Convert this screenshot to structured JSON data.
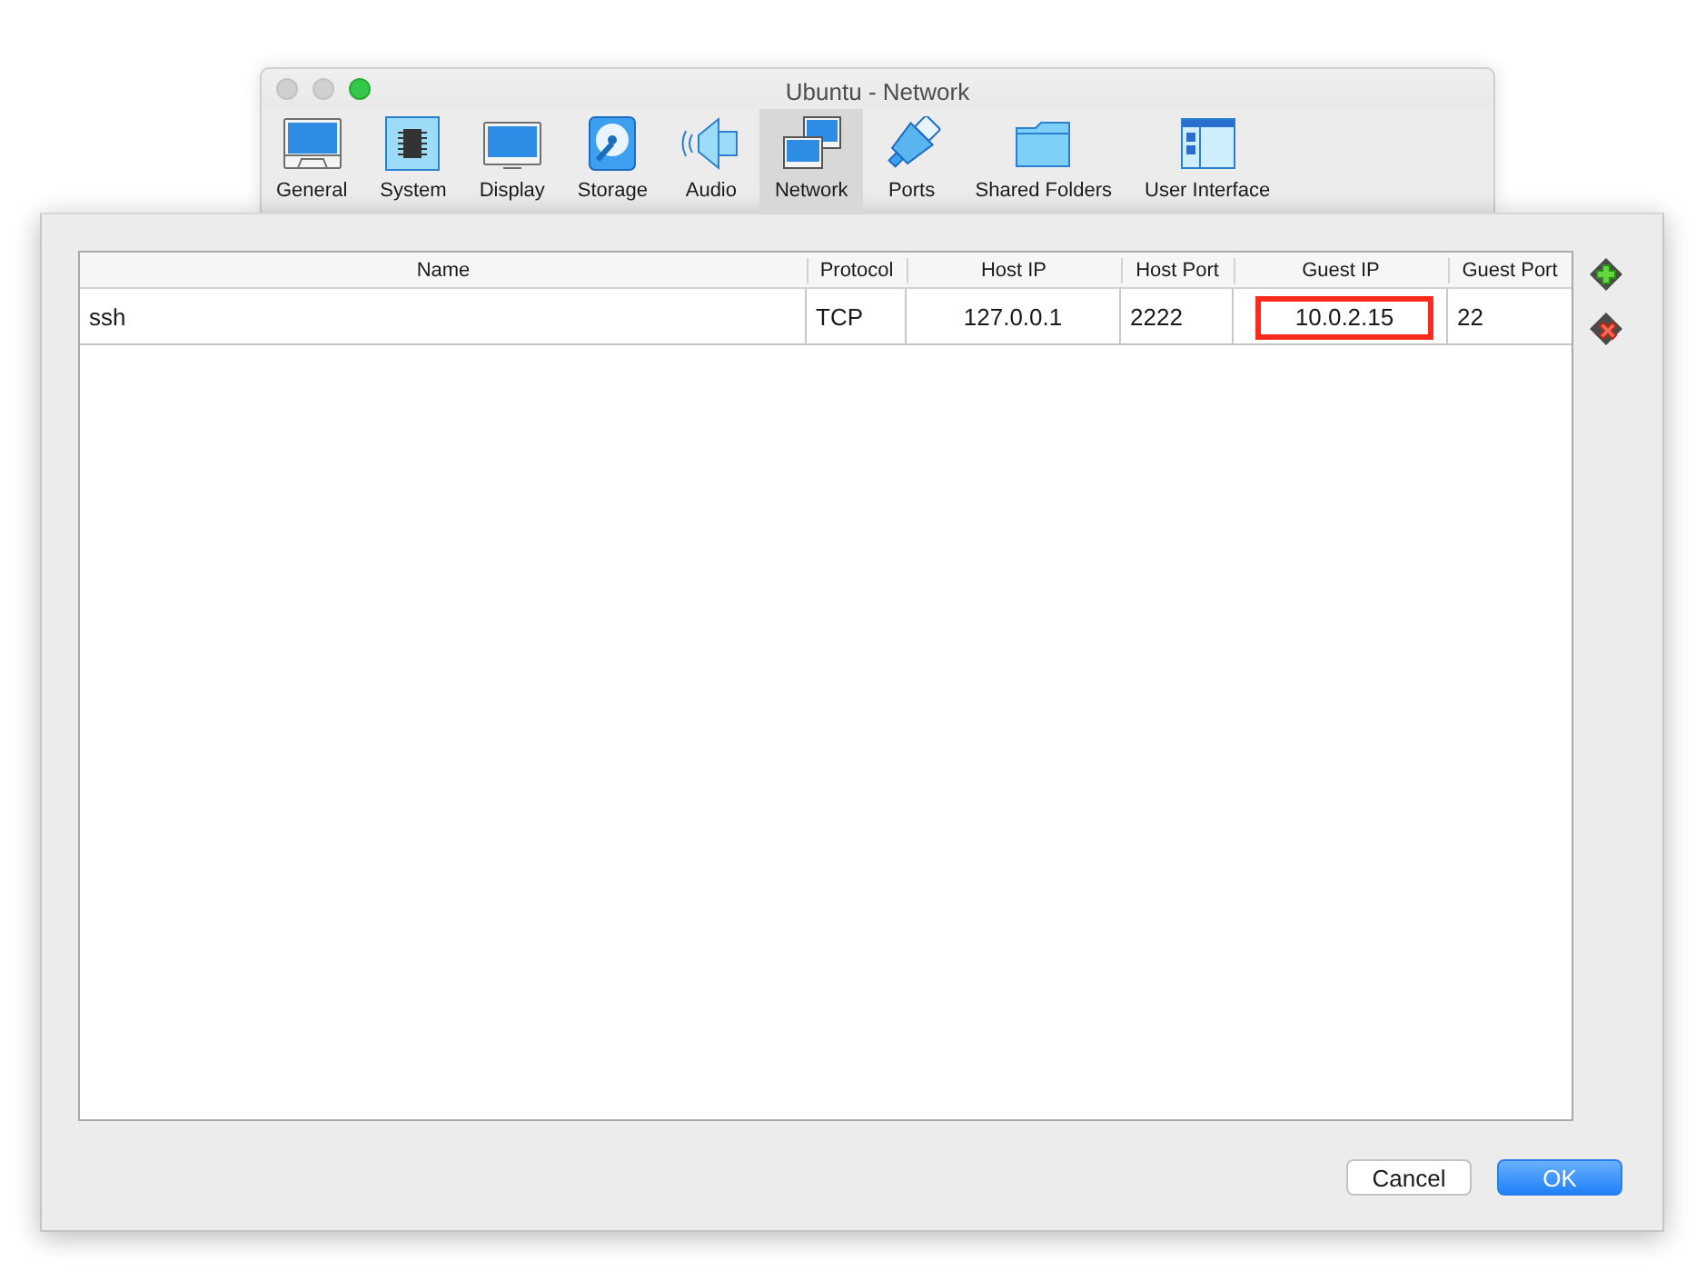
{
  "window": {
    "title": "Ubuntu - Network",
    "controls": [
      {
        "kind": "close",
        "disabled": true
      },
      {
        "kind": "minimize",
        "disabled": true
      },
      {
        "kind": "zoom",
        "disabled": false
      }
    ]
  },
  "tabs": [
    {
      "label": "General",
      "selected": false
    },
    {
      "label": "System",
      "selected": false
    },
    {
      "label": "Display",
      "selected": false
    },
    {
      "label": "Storage",
      "selected": false
    },
    {
      "label": "Audio",
      "selected": false
    },
    {
      "label": "Network",
      "selected": true
    },
    {
      "label": "Ports",
      "selected": false
    },
    {
      "label": "Shared Folders",
      "selected": false
    },
    {
      "label": "User Interface",
      "selected": false
    }
  ],
  "table": {
    "columns": [
      "Name",
      "Protocol",
      "Host IP",
      "Host Port",
      "Guest IP",
      "Guest Port"
    ],
    "rows": [
      {
        "cells": [
          {
            "text": "ssh",
            "highlighted": false
          },
          {
            "text": "TCP",
            "highlighted": false
          },
          {
            "text": "127.0.0.1",
            "highlighted": false
          },
          {
            "text": "2222",
            "highlighted": false
          },
          {
            "text": "10.0.2.15",
            "highlighted": true
          },
          {
            "text": "22",
            "highlighted": false
          }
        ]
      }
    ]
  },
  "buttons": [
    {
      "label": "Cancel",
      "kind": "cancel"
    },
    {
      "label": "OK",
      "kind": "confirm"
    }
  ]
}
